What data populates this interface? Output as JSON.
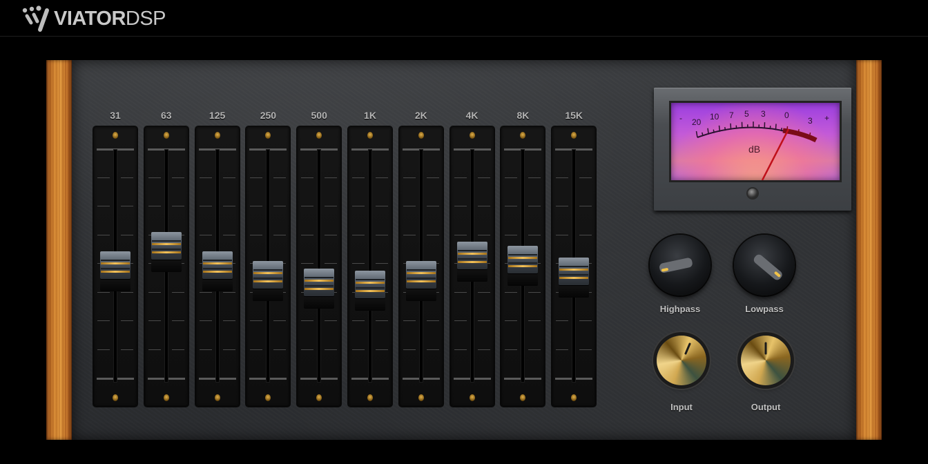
{
  "header": {
    "brand_bold": "VIATOR",
    "brand_light": "DSP"
  },
  "bands": [
    {
      "label": "31",
      "level": 0.46
    },
    {
      "label": "63",
      "level": 0.56
    },
    {
      "label": "125",
      "level": 0.46
    },
    {
      "label": "250",
      "level": 0.41
    },
    {
      "label": "500",
      "level": 0.37
    },
    {
      "label": "1K",
      "level": 0.36
    },
    {
      "label": "2K",
      "level": 0.41
    },
    {
      "label": "4K",
      "level": 0.51
    },
    {
      "label": "8K",
      "level": 0.49
    },
    {
      "label": "15K",
      "level": 0.43
    }
  ],
  "vu_meter": {
    "scale": [
      "-",
      "20",
      "10",
      "7",
      "5",
      "3",
      "0",
      "3",
      "+"
    ],
    "unit": "dB",
    "needle_value": "0"
  },
  "knobs": {
    "highpass": {
      "label": "Highpass"
    },
    "lowpass": {
      "label": "Lowpass"
    },
    "input": {
      "label": "Input"
    },
    "output": {
      "label": "Output"
    }
  },
  "colors": {
    "accent_gold": "#f4c25a",
    "wood": "#d6862f",
    "vu_face": "#c35ad8",
    "needle": "#c0101a"
  }
}
